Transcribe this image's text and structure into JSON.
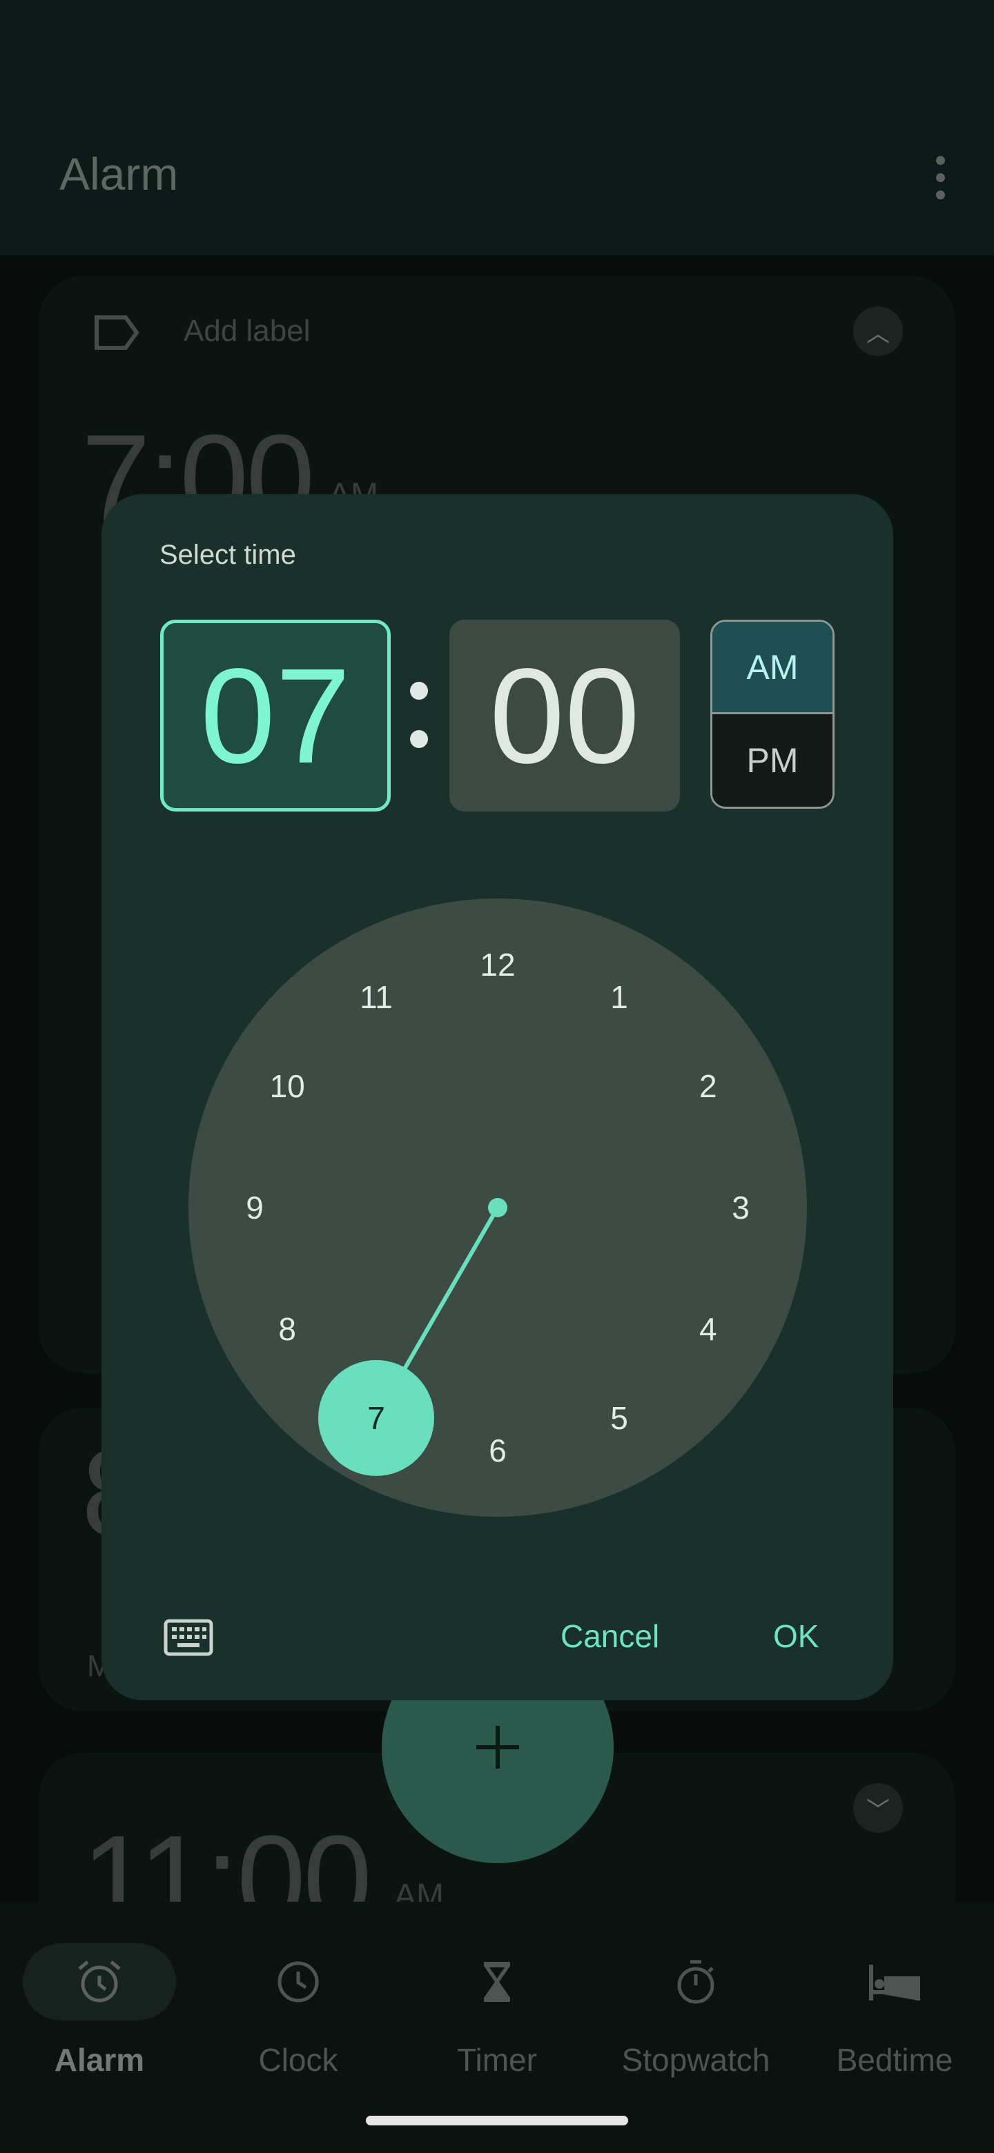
{
  "header": {
    "title": "Alarm",
    "menu_icon": "more-vert-icon"
  },
  "alarms": [
    {
      "label_placeholder": "Add label",
      "time": "7:00",
      "ampm": "AM",
      "expanded": true
    },
    {
      "time": "8",
      "day_initial": "M"
    },
    {
      "time": "11:00",
      "ampm": "AM",
      "expanded": false
    }
  ],
  "dialog": {
    "title": "Select time",
    "hour": "07",
    "minute": "00",
    "am": "AM",
    "pm": "PM",
    "selected_period": "AM",
    "dial_numbers": [
      "12",
      "1",
      "2",
      "3",
      "4",
      "5",
      "6",
      "7",
      "8",
      "9",
      "10",
      "11"
    ],
    "selected_hour": 7,
    "cancel": "Cancel",
    "ok": "OK",
    "keyboard_icon": "keyboard-icon"
  },
  "fab": {
    "icon": "plus-icon"
  },
  "nav": [
    {
      "label": "Alarm",
      "icon": "alarm-icon",
      "active": true
    },
    {
      "label": "Clock",
      "icon": "clock-icon"
    },
    {
      "label": "Timer",
      "icon": "hourglass-icon"
    },
    {
      "label": "Stopwatch",
      "icon": "stopwatch-icon"
    },
    {
      "label": "Bedtime",
      "icon": "bed-icon"
    }
  ],
  "colors": {
    "accent": "#72e8c7",
    "dialog": "#1a312b",
    "dial": "#3d4b45",
    "selector": "#69dfbd"
  }
}
